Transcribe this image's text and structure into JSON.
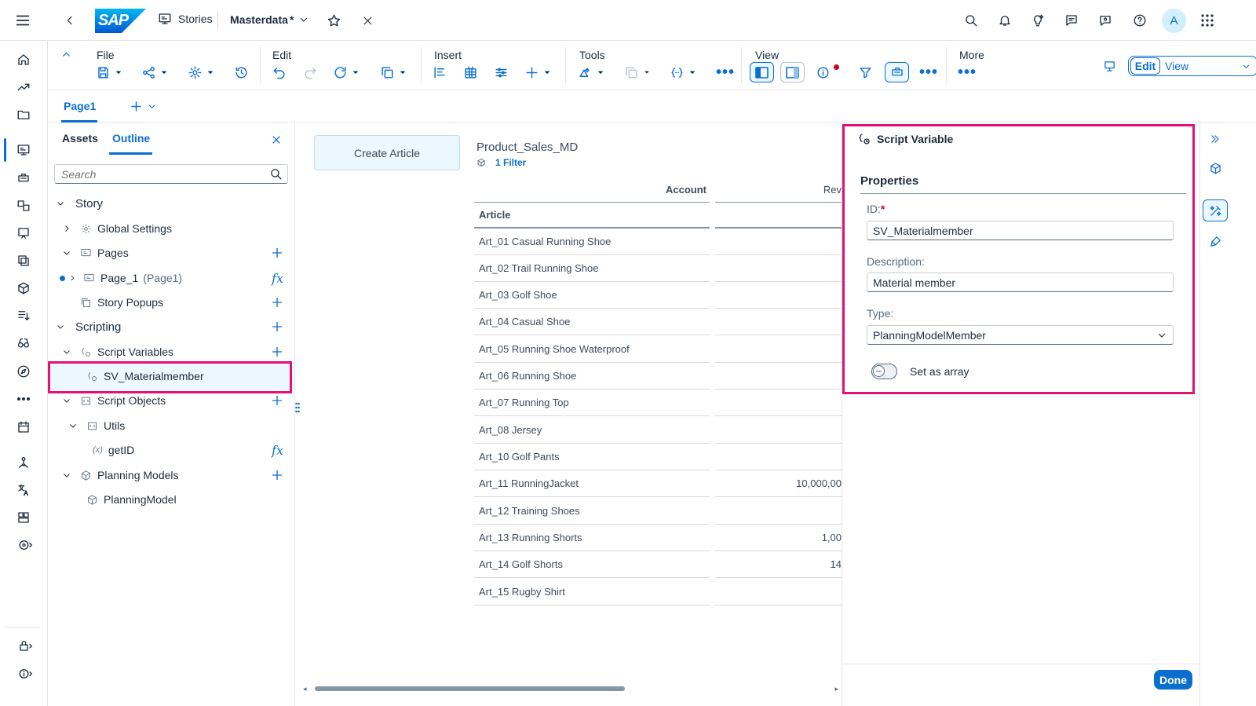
{
  "shell": {
    "logo_text": "SAP",
    "breadcrumb_label": "Stories",
    "story_title": "Masterdata",
    "story_modified_mark": "*",
    "avatar_initial": "A"
  },
  "toolbar": {
    "groups": {
      "file": "File",
      "edit": "Edit",
      "insert": "Insert",
      "tools": "Tools",
      "view": "View",
      "more": "More"
    },
    "mode_edit": "Edit",
    "mode_view": "View"
  },
  "page_tabs": {
    "active_tab": "Page1"
  },
  "left_panel": {
    "tabs": {
      "assets": "Assets",
      "outline": "Outline"
    },
    "search_placeholder": "Search",
    "tree": {
      "story": "Story",
      "global_settings": "Global Settings",
      "pages": "Pages",
      "page_1": "Page_1",
      "page_1_sub": "(Page1)",
      "story_popups": "Story Popups",
      "scripting": "Scripting",
      "script_variables": "Script Variables",
      "sv_materialmember": "SV_Materialmember",
      "script_objects": "Script Objects",
      "utils": "Utils",
      "getid": "getID",
      "planning_models": "Planning Models",
      "planning_model": "PlanningModel"
    }
  },
  "canvas": {
    "create_button": "Create Article",
    "table_title": "Product_Sales_MD",
    "filter_link": "1 Filter",
    "header_account": "Account",
    "header_revenue": "Rev",
    "header_article": "Article",
    "rows": [
      {
        "article": "Art_01 Casual Running Shoe",
        "value": ""
      },
      {
        "article": "Art_02 Trail Running Shoe",
        "value": ""
      },
      {
        "article": "Art_03 Golf Shoe",
        "value": ""
      },
      {
        "article": "Art_04 Casual Shoe",
        "value": ""
      },
      {
        "article": "Art_05 Running Shoe Waterproof",
        "value": ""
      },
      {
        "article": "Art_06 Running Shoe",
        "value": ""
      },
      {
        "article": "Art_07 Running Top",
        "value": ""
      },
      {
        "article": "Art_08 Jersey",
        "value": ""
      },
      {
        "article": "Art_10 Golf Pants",
        "value": ""
      },
      {
        "article": "Art_11 RunningJacket",
        "value": "10,000,00"
      },
      {
        "article": "Art_12 Training Shoes",
        "value": ""
      },
      {
        "article": "Art_13 Running Shorts",
        "value": "1,00"
      },
      {
        "article": "Art_14 Golf Shorts",
        "value": "14"
      },
      {
        "article": "Art_15 Rugby Shirt",
        "value": ""
      }
    ]
  },
  "right_panel": {
    "title": "Script Variable",
    "section": "Properties",
    "id_label": "ID:",
    "id_required": "*",
    "id_value": "SV_Materialmember",
    "description_label": "Description:",
    "description_value": "Material member",
    "type_label": "Type:",
    "type_value": "PlanningModelMember",
    "array_label": "Set as array",
    "array_enabled": false,
    "done_button": "Done"
  },
  "colors": {
    "accent": "#0a6ed1",
    "highlight_border": "#e0127a",
    "text": "#1d2d3e",
    "muted": "#556b82"
  }
}
